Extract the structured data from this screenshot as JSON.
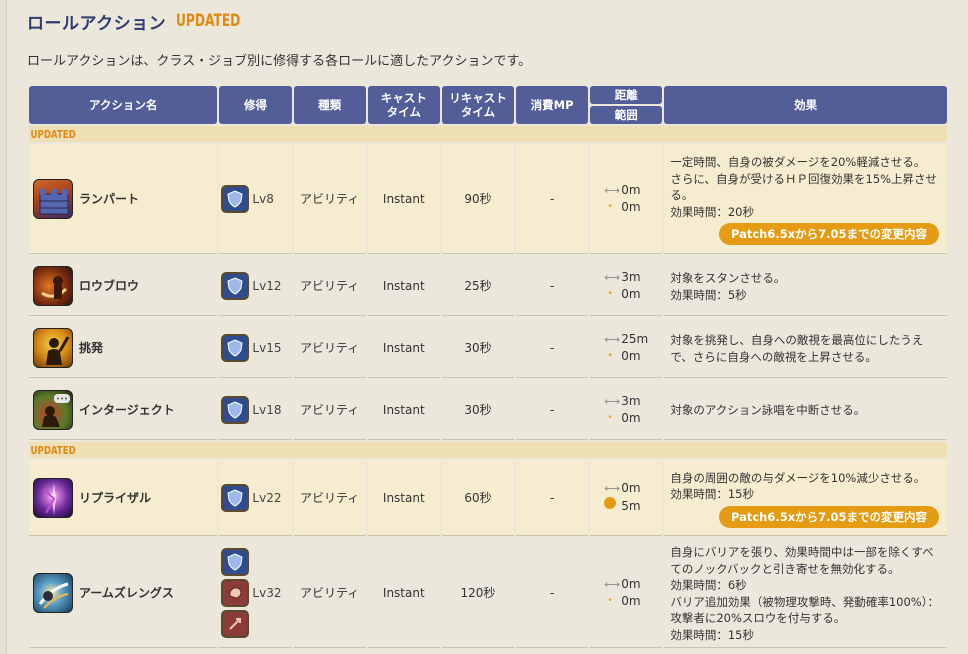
{
  "section": {
    "title": "ロールアクション",
    "updated_tag": "UPDATED",
    "description": "ロールアクションは、クラス・ジョブ別に修得する各ロールに適したアクションです。"
  },
  "table": {
    "headers": {
      "name": "アクション名",
      "acquire": "修得",
      "type": "種類",
      "cast_line1": "キャスト",
      "cast_line2": "タイム",
      "recast_line1": "リキャスト",
      "recast_line2": "タイム",
      "mp": "消費MP",
      "distance": "距離",
      "range": "範囲",
      "effect": "効果"
    },
    "band_label": "UPDATED",
    "patch_label": "Patch6.5xから7.05までの変更内容",
    "rows": [
      {
        "icon": "rampart-icon",
        "name": "ランパート",
        "level": "Lv8",
        "type": "アビリティ",
        "cast": "Instant",
        "recast": "90秒",
        "mp": "-",
        "distance": "0m",
        "range": "0m",
        "effect": [
          "一定時間、自身の被ダメージを20%軽減させる。",
          "さらに、自身が受けるＨＰ回復効果を15%上昇させる。",
          "効果時間：20秒"
        ]
      },
      {
        "icon": "low-blow-icon",
        "name": "ロウブロウ",
        "level": "Lv12",
        "type": "アビリティ",
        "cast": "Instant",
        "recast": "25秒",
        "mp": "-",
        "distance": "3m",
        "range": "0m",
        "effect": [
          "対象をスタンさせる。",
          "効果時間：5秒"
        ]
      },
      {
        "icon": "provoke-icon",
        "name": "挑発",
        "level": "Lv15",
        "type": "アビリティ",
        "cast": "Instant",
        "recast": "30秒",
        "mp": "-",
        "distance": "25m",
        "range": "0m",
        "effect": [
          "対象を挑発し、自身への敵視を最高位にしたうえで、さらに自身への敵視を上昇させる。"
        ]
      },
      {
        "icon": "interject-icon",
        "name": "インタージェクト",
        "level": "Lv18",
        "type": "アビリティ",
        "cast": "Instant",
        "recast": "30秒",
        "mp": "-",
        "distance": "3m",
        "range": "0m",
        "effect": [
          "対象のアクション詠唱を中断させる。"
        ]
      },
      {
        "icon": "reprisal-icon",
        "name": "リプライザル",
        "level": "Lv22",
        "type": "アビリティ",
        "cast": "Instant",
        "recast": "60秒",
        "mp": "-",
        "distance": "0m",
        "range": "5m",
        "effect": [
          "自身の周囲の敵の与ダメージを10%減少させる。",
          "効果時間：15秒"
        ]
      },
      {
        "icon": "arms-length-icon",
        "name": "アームズレングス",
        "level": "Lv32",
        "type": "アビリティ",
        "cast": "Instant",
        "recast": "120秒",
        "mp": "-",
        "distance": "0m",
        "range": "0m",
        "effect": [
          "自身にバリアを張り、効果時間中は一部を除くすべてのノックバックと引き寄せを無効化する。",
          "効果時間：6秒",
          "バリア追加効果（被物理攻撃時、発動確率100%）：攻撃者に20%スロウを付与する。",
          "効果時間：15秒"
        ]
      }
    ]
  },
  "colors": {
    "header_bg": "#535d98",
    "title_color": "#2d3a73",
    "updated_color": "#e08a12",
    "pill_bg": "#e59b14",
    "highlight_row_bg": "#f6ecd0"
  }
}
